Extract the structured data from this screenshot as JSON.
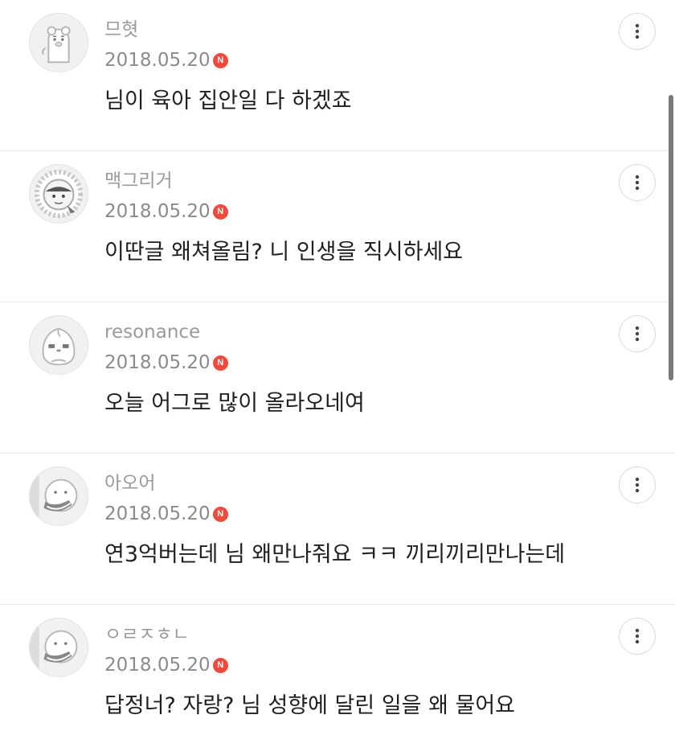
{
  "comments": [
    {
      "nickname": "므혓",
      "date": "2018.05.20",
      "badge": "N",
      "text": "님이 육아 집안일 다 하겠죠",
      "avatar_icon": "ryan-character-icon",
      "more_icon": "more-vertical-icon"
    },
    {
      "nickname": "맥그리거",
      "date": "2018.05.20",
      "badge": "N",
      "text": "이딴글 왜쳐올림? 니 인생을 직시하세요",
      "avatar_icon": "frodo-character-icon",
      "more_icon": "more-vertical-icon"
    },
    {
      "nickname": "resonance",
      "date": "2018.05.20",
      "badge": "N",
      "text": "오늘 어그로 많이 올라오네여",
      "avatar_icon": "apeach-character-icon",
      "more_icon": "more-vertical-icon"
    },
    {
      "nickname": "아오어",
      "date": "2018.05.20",
      "badge": "N",
      "text": "연3억버는데 님 왜만나줘요 ㅋㅋ 끼리끼리만나는데",
      "avatar_icon": "apeach-hand-icon",
      "more_icon": "more-vertical-icon"
    },
    {
      "nickname": "ㅇㄹㅈㅎㄴ",
      "date": "2018.05.20",
      "badge": "N",
      "text": "답정너? 자랑? 님 성향에 달린 일을 왜 물어요",
      "avatar_icon": "apeach-hand-icon",
      "more_icon": "more-vertical-icon"
    }
  ],
  "colors": {
    "badge": "#ef4a3d",
    "nickname": "#9a9a9a",
    "date": "#8b8b8b",
    "text": "#1f1f1f"
  }
}
